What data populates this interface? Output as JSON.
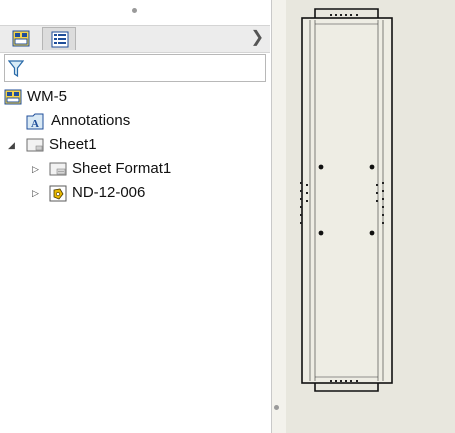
{
  "tree": {
    "root": {
      "label": "WM-5",
      "icon": "drawing-icon"
    },
    "annotations": {
      "label": "Annotations",
      "icon": "annotations-icon"
    },
    "sheet": {
      "label": "Sheet1",
      "icon": "sheet-icon"
    },
    "sheet_format": {
      "label": "Sheet Format1",
      "icon": "sheet-format-icon"
    },
    "view": {
      "label": "ND-12-006",
      "icon": "part-view-icon"
    }
  },
  "tabs": [
    {
      "name": "featuremanager-tab",
      "icon": "feature-tree-icon"
    },
    {
      "name": "property-manager-tab",
      "icon": "property-list-icon"
    }
  ],
  "filter": {
    "icon": "filter-icon"
  },
  "colors": {
    "panel_bg": "#ffffff",
    "graphics_bg": "#e8e7de",
    "sheet_bg": "#eeede4",
    "icon_yellow": "#e8b800",
    "icon_blue": "#1f4e9a"
  }
}
